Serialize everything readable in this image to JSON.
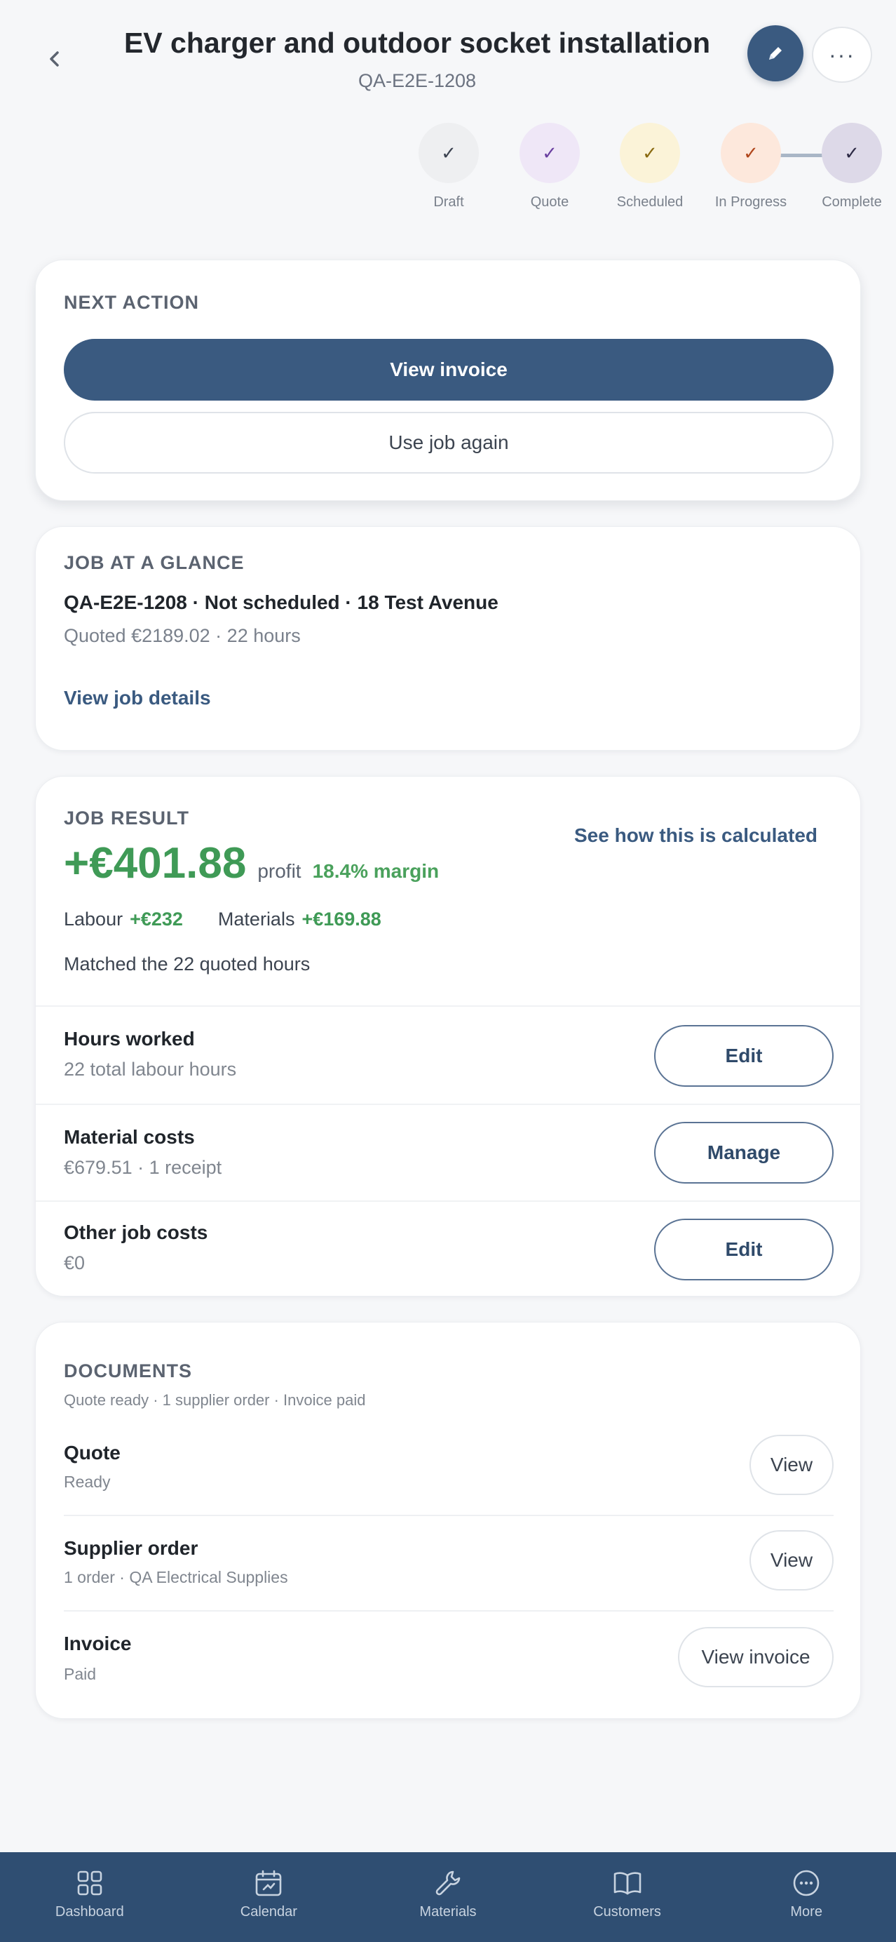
{
  "header": {
    "title": "EV charger and outdoor socket installation",
    "subtitle": "QA-E2E-1208",
    "back_icon": "chevron-left-icon",
    "edit_icon": "pencil-icon",
    "more_label": "···"
  },
  "stepper": {
    "steps": [
      {
        "label": "Draft",
        "check": "✓",
        "bg": "#eeeff1",
        "color": "#3b4250"
      },
      {
        "label": "Quote",
        "check": "✓",
        "bg": "#efe7f7",
        "color": "#6a3fa0"
      },
      {
        "label": "Scheduled",
        "check": "✓",
        "bg": "#fbf3d8",
        "color": "#8a6a10"
      },
      {
        "label": "In Progress",
        "check": "✓",
        "bg": "#fde8dc",
        "color": "#b0461c"
      },
      {
        "label": "Complete",
        "check": "✓",
        "bg": "#ddd9e8",
        "color": "#2d2a45"
      }
    ]
  },
  "next_action": {
    "label": "NEXT ACTION",
    "primary": "View invoice",
    "secondary": "Use job again"
  },
  "glance": {
    "label": "JOB AT A GLANCE",
    "line1": "QA-E2E-1208 · Not scheduled · 18 Test Avenue",
    "line2": "Quoted €2189.02 · 22 hours",
    "link": "View job details"
  },
  "result": {
    "label": "JOB RESULT",
    "calc_link": "See how this is calculated",
    "profit": "+€401.88",
    "profit_word": "profit",
    "margin": "18.4% margin",
    "labour_label": "Labour",
    "labour_value": "+€232",
    "materials_label": "Materials",
    "materials_value": "+€169.88",
    "note": "Matched the 22 quoted hours",
    "items": [
      {
        "title": "Hours worked",
        "sub": "22 total labour hours",
        "button": "Edit"
      },
      {
        "title": "Material costs",
        "sub": "€679.51 · 1 receipt",
        "button": "Manage"
      },
      {
        "title": "Other job costs",
        "sub": "€0",
        "button": "Edit"
      }
    ]
  },
  "documents": {
    "label": "DOCUMENTS",
    "summary": "Quote ready · 1 supplier order · Invoice paid",
    "items": [
      {
        "title": "Quote",
        "sub": "Ready",
        "button": "View"
      },
      {
        "title": "Supplier order",
        "sub": "1 order · QA Electrical Supplies",
        "button": "View"
      },
      {
        "title": "Invoice",
        "sub": "Paid",
        "button": "View invoice"
      }
    ]
  },
  "nav": {
    "items": [
      {
        "label": "Dashboard",
        "icon": "grid-icon"
      },
      {
        "label": "Calendar",
        "icon": "calendar-icon"
      },
      {
        "label": "Materials",
        "icon": "wrench-icon"
      },
      {
        "label": "Customers",
        "icon": "book-icon"
      },
      {
        "label": "More",
        "icon": "more-circle-icon"
      }
    ]
  }
}
